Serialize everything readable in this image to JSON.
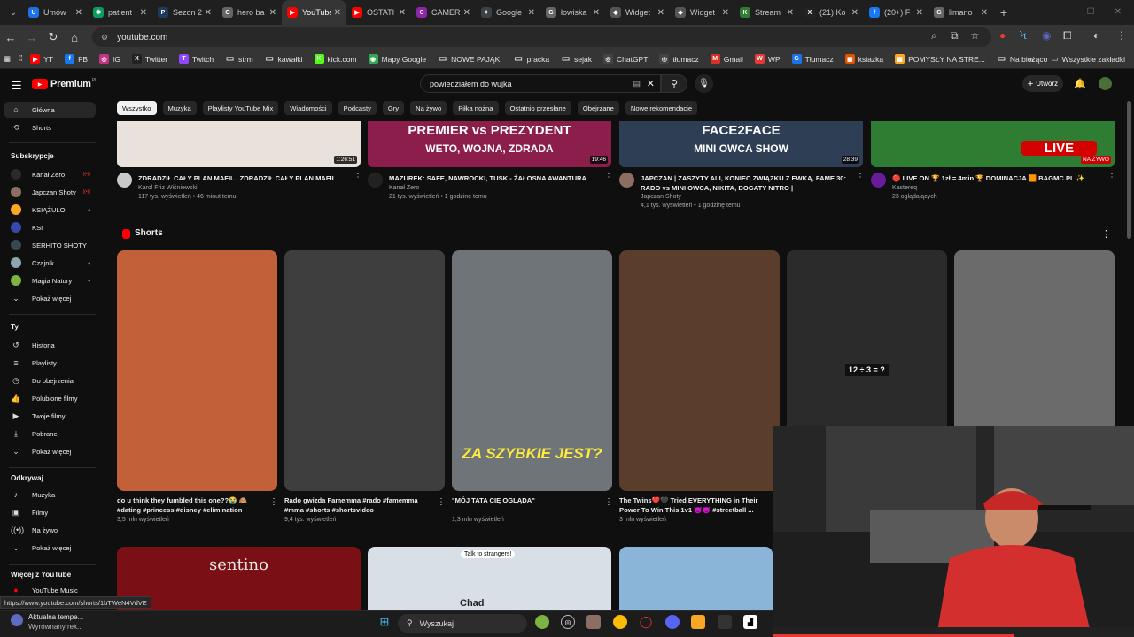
{
  "browser": {
    "tabs": [
      {
        "title": "Umów",
        "color": "#1a73e8",
        "glyph": "U"
      },
      {
        "title": "patient",
        "color": "#0a9e5e",
        "glyph": "✱"
      },
      {
        "title": "Sezon 2",
        "color": "#1f3a5f",
        "glyph": "P"
      },
      {
        "title": "hero ba",
        "color": "#666666",
        "glyph": "G"
      },
      {
        "title": "YouTube",
        "color": "#ff0000",
        "glyph": "▶",
        "active": true
      },
      {
        "title": "OSTATI",
        "color": "#ff0000",
        "glyph": "▶"
      },
      {
        "title": "CAMER",
        "color": "#8e24aa",
        "glyph": "C"
      },
      {
        "title": "Google",
        "color": "#3c4043",
        "glyph": "✦"
      },
      {
        "title": "łowiska",
        "color": "#666666",
        "glyph": "G"
      },
      {
        "title": "Widget",
        "color": "#555555",
        "glyph": "◆"
      },
      {
        "title": "Widget",
        "color": "#555555",
        "glyph": "◆"
      },
      {
        "title": "Stream",
        "color": "#2e7d32",
        "glyph": "K"
      },
      {
        "title": "(21) Ko",
        "color": "#222222",
        "glyph": "X"
      },
      {
        "title": "(20+) F",
        "color": "#1877f2",
        "glyph": "f"
      },
      {
        "title": "limano",
        "color": "#666666",
        "glyph": "G"
      }
    ],
    "url": "youtube.com",
    "bookmarks": [
      {
        "label": "YT",
        "color": "#ff0000",
        "glyph": "▶"
      },
      {
        "label": "FB",
        "color": "#1877f2",
        "glyph": "f"
      },
      {
        "label": "IG",
        "color": "#c13584",
        "glyph": "◎"
      },
      {
        "label": "Twitter",
        "color": "#222222",
        "glyph": "X"
      },
      {
        "label": "Twitch",
        "color": "#9146ff",
        "glyph": "T"
      },
      {
        "label": "strm",
        "color": "",
        "glyph": "folder"
      },
      {
        "label": "kawałki",
        "color": "",
        "glyph": "folder"
      },
      {
        "label": "kick.com",
        "color": "#53fc18",
        "glyph": "K"
      },
      {
        "label": "Mapy Google",
        "color": "#34a853",
        "glyph": "◉"
      },
      {
        "label": "NOWE PAJĄKI",
        "color": "",
        "glyph": "folder"
      },
      {
        "label": "pracka",
        "color": "",
        "glyph": "folder"
      },
      {
        "label": "sejak",
        "color": "",
        "glyph": "folder"
      },
      {
        "label": "ChatGPT",
        "color": "#444444",
        "glyph": "◎"
      },
      {
        "label": "tłumacz",
        "color": "#444444",
        "glyph": "◎"
      },
      {
        "label": "Gmail",
        "color": "#d93025",
        "glyph": "M"
      },
      {
        "label": "WP",
        "color": "#e53935",
        "glyph": "W"
      },
      {
        "label": "Tłumacz",
        "color": "#1a73e8",
        "glyph": "G"
      },
      {
        "label": "ksiazka",
        "color": "#e65100",
        "glyph": "▦"
      },
      {
        "label": "POMYSŁY NA STRE...",
        "color": "#f9a825",
        "glyph": "▦"
      },
      {
        "label": "Na bieżąco",
        "color": "",
        "glyph": "folder"
      }
    ],
    "bookmarks_overflow": "»",
    "all_bookmarks": "Wszystkie zakładki",
    "status_url": "https://www.youtube.com/shorts/1bTWeN4VdVE"
  },
  "youtube": {
    "logo_text": "Premium",
    "logo_superscript": "PL",
    "search_value": "powiedziałem do wujka",
    "create_label": "Utwórz",
    "chips": [
      "Wszystko",
      "Muzyka",
      "Playlisty YouTube Mix",
      "Wiadomości",
      "Podcasty",
      "Gry",
      "Na żywo",
      "Piłka nożna",
      "Ostatnio przesłane",
      "Obejrzane",
      "Nowe rekomendacje"
    ],
    "sidebar": {
      "main": [
        "Główna",
        "Shorts"
      ],
      "subs_header": "Subskrypcje",
      "subs": [
        {
          "label": "Kanał Zero",
          "color": "#2a2a2a",
          "live": true
        },
        {
          "label": "Japczan Shoty",
          "color": "#8d6e63",
          "live": true
        },
        {
          "label": "KSIĄŻULO",
          "color": "#f9a825",
          "live": false,
          "dot": true
        },
        {
          "label": "KSI",
          "color": "#3949ab",
          "live": false
        },
        {
          "label": "SERHITO SHOTY",
          "color": "#37474f",
          "live": false
        },
        {
          "label": "Czajnik",
          "color": "#90a4ae",
          "live": false,
          "dot": true
        },
        {
          "label": "Magia Natury",
          "color": "#7cb342",
          "live": false,
          "dot": true
        }
      ],
      "subs_more": "Pokaż więcej",
      "you_header": "Ty",
      "you": [
        "Historia",
        "Playlisty",
        "Do obejrzenia",
        "Polubione filmy",
        "Twoje filmy",
        "Pobrane",
        "Pokaż więcej"
      ],
      "explore_header": "Odkrywaj",
      "explore": [
        "Muzyka",
        "Filmy",
        "Na żywo",
        "Pokaż więcej"
      ],
      "more_header": "Więcej z YouTube",
      "more": [
        "YouTube Music"
      ]
    },
    "videos": [
      {
        "title": "ZDRADZIŁ CAŁY PLAN MAFII... ZDRADZIŁ CAŁY PLAN MAFII",
        "channel": "Karol Friz Wiśniewski",
        "meta": "117 tys. wyświetleń • 46 minut temu",
        "duration": "1:26:51",
        "avatar": "#c9c9c9",
        "thumb": "#e9e2dc"
      },
      {
        "title": "MAZUREK: SAFE, NAWROCKI, TUSK - ŻAŁOSNA AWANTURA",
        "channel": "Kanał Zero",
        "meta": "21 tys. wyświetleń • 1 godzinę temu",
        "duration": "19:46",
        "avatar": "#222222",
        "thumb": "#8b1e4a",
        "overlay1": "PREMIER vs PREZYDENT",
        "overlay2": "WETO, WOJNA, ZDRADA"
      },
      {
        "title": "JAPCZAN | ZASZYTY ALI, KONIEC ZWIĄZKU Z EWKĄ, FAME 30: RADO vs MINI OWCA, NIKITA, BOGATY NITRO |",
        "channel": "Japczan Shoty",
        "meta": "4,1 tys. wyświetleń • 1 godzinę temu",
        "duration": "28:39",
        "avatar": "#8d6e63",
        "thumb": "#2d3e55",
        "overlay1": "FACE2FACE",
        "overlay2": "MINI OWCA SHOW"
      },
      {
        "title": "🔴 LIVE ON 🏆 1zł = 4min 🏆 DOMINACJA 🟧 BAGMC.PL ✨",
        "channel": "Kastereq",
        "meta": "23 oglądających",
        "duration": "NA ŻYWO",
        "avatar": "#6a1b9a",
        "thumb": "#2e7d32",
        "overlay1": "LIVE"
      }
    ],
    "shorts_header": "Shorts",
    "shorts": [
      {
        "title": "do u think they fumbled this one??😭 🙈 #dating #princess #disney #elimination",
        "views": "3,5 mln wyświetleń",
        "thumb": "#c2603a"
      },
      {
        "title": "Rado gwizda Famemma #rado #famemma #mma #shorts #shortsvideo",
        "views": "9,4 tys. wyświetleń",
        "thumb": "#3e3e3e"
      },
      {
        "title": "\"MÓJ TATA CIĘ OGLĄDA\"",
        "views": "1,3 mln wyświetleń",
        "thumb": "#6f7478",
        "caption": "ZA SZYBKIE JEST?"
      },
      {
        "title": "The Twins❤️🖤 Tried EVERYTHING in Their Power To Win This 1v1 😈👿 #streetball ...",
        "views": "3 mln wyświetleń",
        "thumb": "#5a3d2b"
      },
      {
        "title": "",
        "views": "",
        "thumb": "#2b2b2b",
        "caption": "12 ÷ 3 = ?"
      },
      {
        "title": "",
        "views": "",
        "thumb": "#6b6b6b"
      }
    ],
    "bottom": [
      {
        "label": "sentino",
        "thumb": "#7a1015"
      },
      {
        "label": "Talk to strangers!",
        "sub": "Chad",
        "thumb": "#d8dfe6"
      },
      {
        "label": "",
        "thumb": "#8ab4d8"
      }
    ]
  },
  "taskbar": {
    "weather_title": "Aktualna tempe...",
    "weather_sub": "Wyrównany rek...",
    "search_placeholder": "Wyszukaj"
  }
}
